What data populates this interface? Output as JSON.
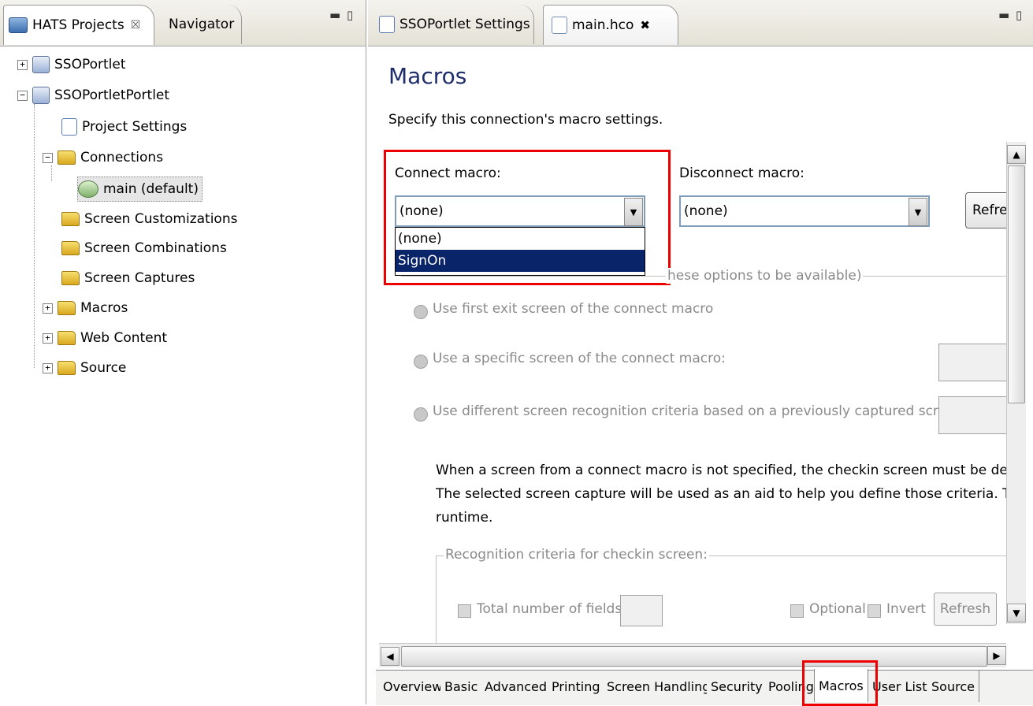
{
  "left_panel": {
    "tabs": [
      {
        "label": "HATS Projects",
        "close": "☒"
      },
      {
        "label": "Navigator"
      }
    ],
    "tree": [
      {
        "label": "SSOPortlet"
      },
      {
        "label": "SSOPortletPortlet"
      },
      {
        "label": "Project Settings"
      },
      {
        "label": "Connections"
      },
      {
        "label": "main (default)"
      },
      {
        "label": "Screen Customizations"
      },
      {
        "label": "Screen Combinations"
      },
      {
        "label": "Screen Captures"
      },
      {
        "label": "Macros"
      },
      {
        "label": "Web Content"
      },
      {
        "label": "Source"
      }
    ]
  },
  "editor": {
    "tabs": [
      {
        "label": "SSOPortlet Settings"
      },
      {
        "label": "main.hco",
        "close": "✖"
      }
    ],
    "title": "Macros",
    "description": "Specify this connection's macro settings.",
    "connect_macro": {
      "label": "Connect macro:",
      "value": "(none)",
      "options": [
        "(none)",
        "SignOn"
      ],
      "selected_index": 1
    },
    "disconnect_macro": {
      "label": "Disconnect macro:",
      "value": "(none)"
    },
    "refresh_label": "Refre",
    "checkin_group": "Checkin screen: (You must enable pooling for these options to be available)",
    "checkin_group_visible_tail": "hese options to be available)",
    "radio1": "Use first exit screen of the connect macro",
    "radio2": "Use a specific screen of the connect macro:",
    "radio3": "Use different screen recognition criteria based on a previously captured screen:",
    "info_text": [
      "When a screen from a connect macro is not specified, the checkin screen must be defined explicitly",
      "The selected screen capture will be used as an aid to help you define those criteria. The screen ca",
      "runtime."
    ],
    "recog_group": "Recognition criteria for checkin screen:",
    "total_fields": "Total number of fields:",
    "optional": "Optional",
    "invert": "Invert",
    "refresh_small": "Refresh",
    "bottom_tabs": [
      "Overview",
      "Basic",
      "Advanced",
      "Printing",
      "Screen Handling",
      "Security",
      "Pooling",
      "Macros",
      "User List",
      "Source"
    ],
    "active_bottom_tab": "Macros"
  },
  "colors": {
    "highlight": "#e00000",
    "selection": "#0a246a",
    "title": "#1f2d6a"
  }
}
